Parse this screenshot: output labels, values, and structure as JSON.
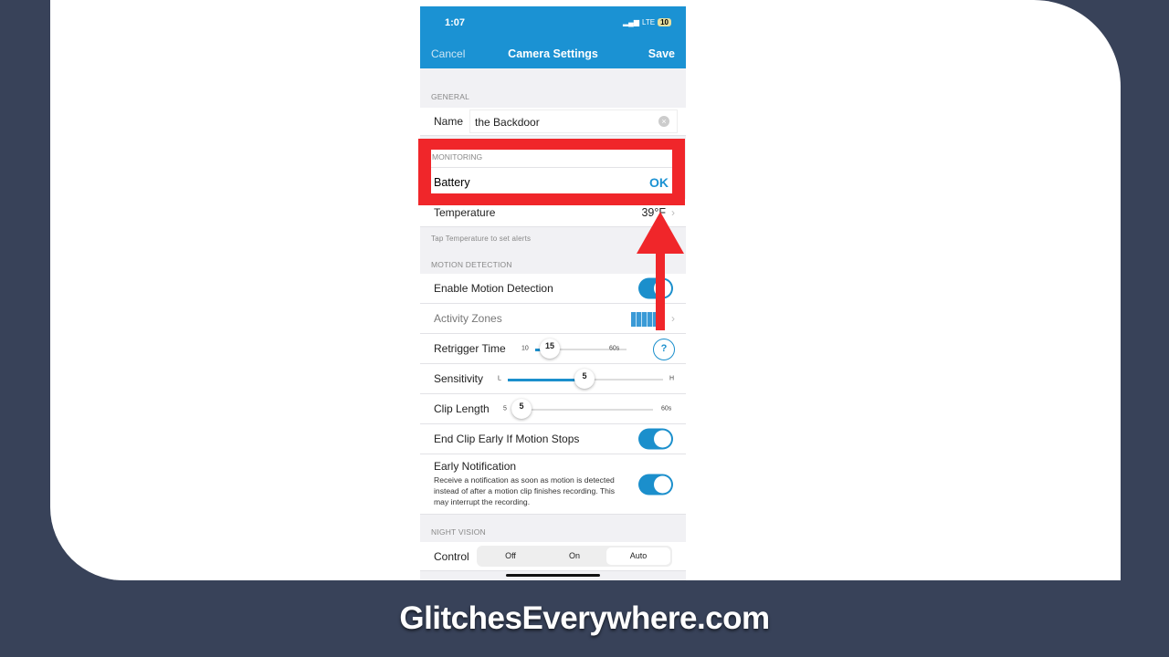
{
  "status": {
    "time": "1:07",
    "network": "LTE",
    "battery": "10"
  },
  "nav": {
    "cancel": "Cancel",
    "title": "Camera Settings",
    "save": "Save"
  },
  "general": {
    "header": "GENERAL",
    "name_label": "Name",
    "name_value": "the Backdoor"
  },
  "monitoring": {
    "header": "MONITORING",
    "battery_label": "Battery",
    "battery_value": "OK",
    "temperature_label": "Temperature",
    "temperature_value": "39°F",
    "hint": "Tap Temperature to set alerts"
  },
  "motion": {
    "header": "MOTION DETECTION",
    "enable_label": "Enable Motion Detection",
    "enable_on": true,
    "zones_label": "Activity Zones",
    "retrigger": {
      "label": "Retrigger Time",
      "min": "10",
      "max": "60s",
      "value": "15",
      "help": "?"
    },
    "sensitivity": {
      "label": "Sensitivity",
      "min": "L",
      "max": "H",
      "value": "5"
    },
    "clip": {
      "label": "Clip Length",
      "min": "5",
      "max": "60s",
      "value": "5"
    },
    "end_clip_label": "End Clip Early If Motion Stops",
    "end_clip_on": true,
    "early": {
      "label": "Early Notification",
      "desc": "Receive a notification as soon as motion is detected instead of after a motion clip finishes recording. This may interrupt the recording.",
      "on": true
    }
  },
  "night": {
    "header": "NIGHT VISION",
    "control_label": "Control",
    "options": [
      "Off",
      "On",
      "Auto"
    ],
    "selected": "Auto"
  },
  "highlight_color": "#f0262a",
  "accent": "#1b92d3",
  "footer": "GlitchesEverywhere.com"
}
